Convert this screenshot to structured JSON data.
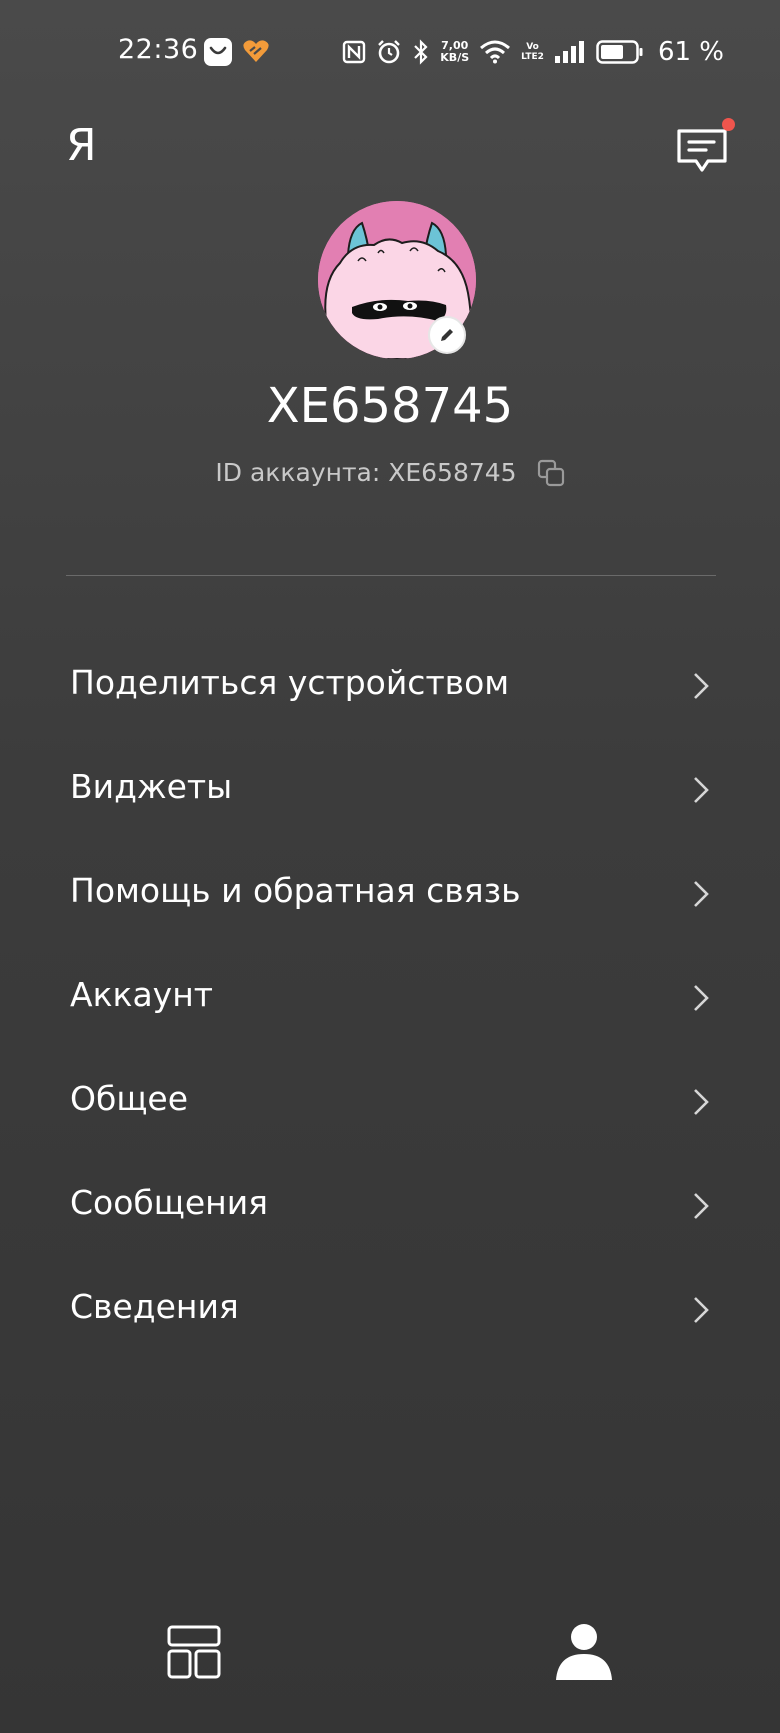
{
  "status_bar": {
    "time": "22:36",
    "speed_value": "7,00",
    "speed_unit": "KB/S",
    "volte_top": "Vo",
    "volte_bottom": "LTE2",
    "battery_percent": "61 %",
    "icons": [
      "app-face-icon",
      "app-heart-icon",
      "nfc-icon",
      "alarm-icon",
      "bluetooth-icon",
      "wifi-icon",
      "signal-icon",
      "battery-icon"
    ],
    "battery_level": 0.61
  },
  "header": {
    "title": "Я",
    "messages_icon": "chat-icon",
    "has_unread": true,
    "unread_color": "#f0554d"
  },
  "profile": {
    "username": "XE658745",
    "account_id_label": "ID аккаунта: XE658745",
    "avatar_color": "#e27fb2",
    "avatar_icon": "monster-avatar",
    "edit_icon": "pencil-icon",
    "copy_icon": "copy-icon"
  },
  "menu": {
    "items": [
      {
        "label": "Поделиться устройством"
      },
      {
        "label": "Виджеты"
      },
      {
        "label": "Помощь и обратная связь"
      },
      {
        "label": "Аккаунт"
      },
      {
        "label": "Общее"
      },
      {
        "label": "Сообщения"
      },
      {
        "label": "Сведения"
      }
    ]
  },
  "bottom_nav": {
    "items": [
      {
        "icon": "layout-icon",
        "active": false
      },
      {
        "icon": "person-icon",
        "active": true
      }
    ]
  }
}
